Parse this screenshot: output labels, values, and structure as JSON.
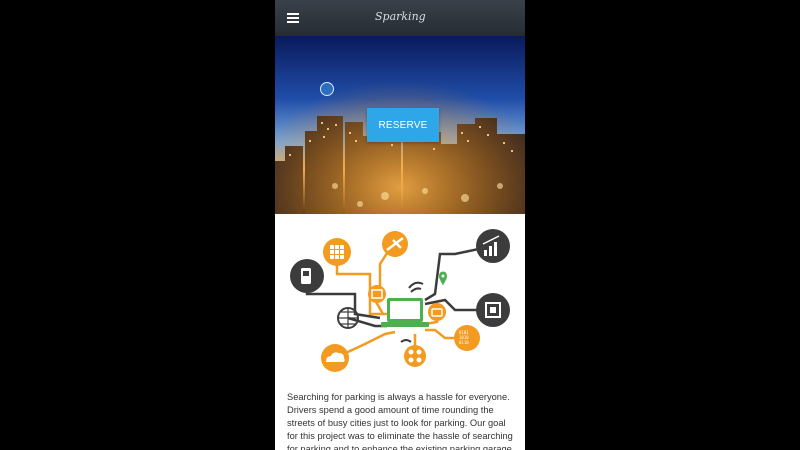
{
  "header": {
    "app_name": "Sparking",
    "menu_icon": "hamburger-menu-icon"
  },
  "hero": {
    "background": "night-city-skyline",
    "reserve_button_label": "RESERVE",
    "accent_color": "#2fa6e7"
  },
  "illustration": {
    "center_icon": "laptop-icon",
    "icons": [
      "grid-icon",
      "satellite-icon",
      "bar-chart-icon",
      "phone-icon",
      "wifi-icon",
      "location-pin-icon",
      "memory-card-icon",
      "chip-icon",
      "globe-icon",
      "camera-icon",
      "code-icon",
      "cloud-icon",
      "network-icon"
    ],
    "colors": {
      "orange": "#f39a21",
      "dark": "#3c3c3c",
      "green": "#4cb050"
    }
  },
  "description": {
    "text": "Searching for parking is always a hassle for everyone. Drivers spend a good amount of time rounding the streets of busy cities just to look for parking. Our goal for this project was to eliminate the hassle of searching for parking and to enhance the existing parking garage system. This"
  }
}
